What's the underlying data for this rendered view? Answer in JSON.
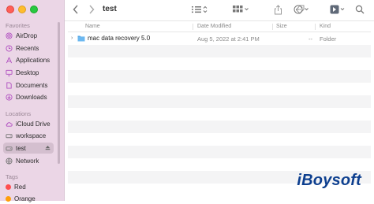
{
  "window": {
    "title": "test"
  },
  "sidebar": {
    "favorites_heading": "Favorites",
    "favorites": [
      {
        "label": "AirDrop",
        "icon": "airdrop-icon"
      },
      {
        "label": "Recents",
        "icon": "clock-icon"
      },
      {
        "label": "Applications",
        "icon": "applications-icon"
      },
      {
        "label": "Desktop",
        "icon": "desktop-icon"
      },
      {
        "label": "Documents",
        "icon": "document-icon"
      },
      {
        "label": "Downloads",
        "icon": "download-icon"
      }
    ],
    "locations_heading": "Locations",
    "locations": [
      {
        "label": "iCloud Drive",
        "icon": "cloud-icon"
      },
      {
        "label": "workspace",
        "icon": "drive-icon"
      },
      {
        "label": "test",
        "icon": "drive-icon",
        "selected": true
      },
      {
        "label": "Network",
        "icon": "globe-icon"
      }
    ],
    "tags_heading": "Tags",
    "tags": [
      {
        "label": "Red",
        "color": "#ff4d4f"
      },
      {
        "label": "Orange",
        "color": "#ff9f0a"
      }
    ]
  },
  "columns": {
    "name": "Name",
    "date": "Date Modified",
    "size": "Size",
    "kind": "Kind"
  },
  "files": [
    {
      "name": "mac data recovery 5.0",
      "date": "Aug 5, 2022 at 2:41 PM",
      "size": "--",
      "kind": "Folder"
    }
  ],
  "watermark": "iBoysoft",
  "colors": {
    "sidebar": "#ebd6e6",
    "folder": "#5aa9e6",
    "brand": "#0d3f8f"
  }
}
